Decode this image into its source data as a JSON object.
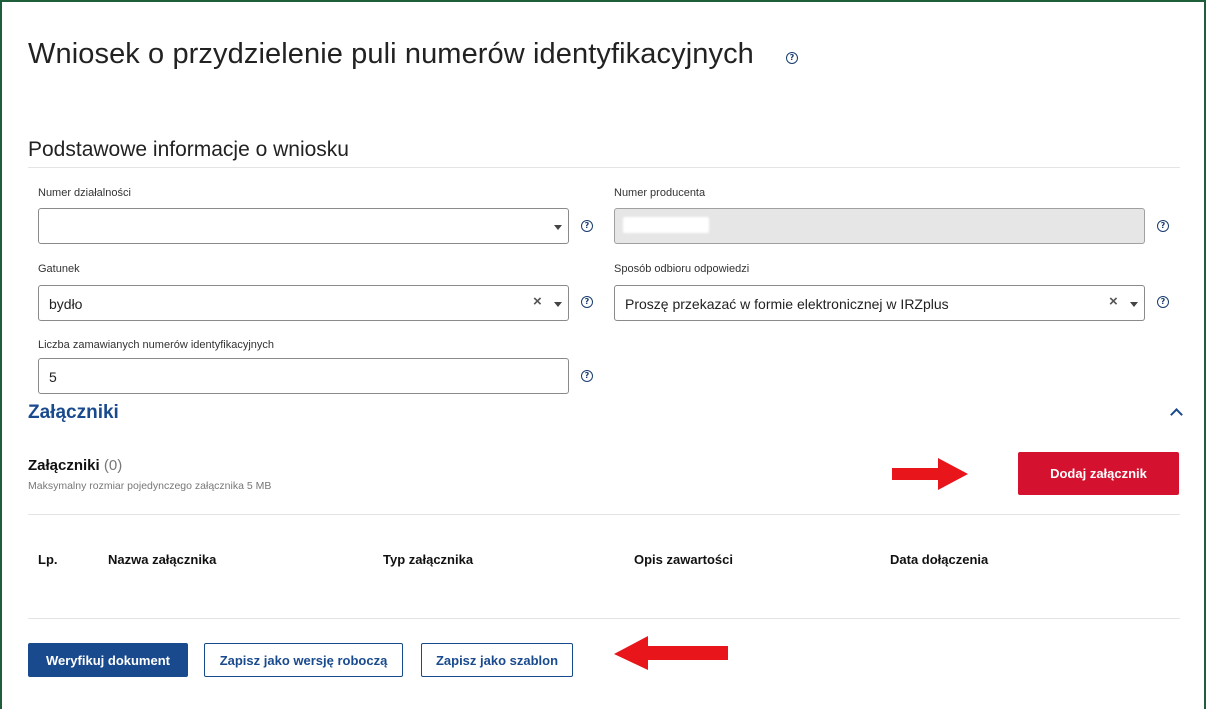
{
  "page": {
    "title": "Wniosek o przydzielenie puli numerów identyfikacyjnych",
    "section_title": "Podstawowe informacje o wniosku"
  },
  "form": {
    "numer_dzialalnosci": {
      "label": "Numer działalności",
      "value": ""
    },
    "numer_producenta": {
      "label": "Numer producenta",
      "value": ""
    },
    "gatunek": {
      "label": "Gatunek",
      "value": "bydło"
    },
    "sposob_odbioru": {
      "label": "Sposób odbioru odpowiedzi",
      "value": "Proszę przekazać w formie elektronicznej w IRZplus"
    },
    "liczba_numerow": {
      "label": "Liczba zamawianych numerów identyfikacyjnych",
      "value": "5"
    }
  },
  "attachments": {
    "heading": "Załączniki",
    "list_title": "Załączniki",
    "count": "(0)",
    "max_size_note": "Maksymalny rozmiar pojedynczego załącznika 5 MB",
    "add_button": "Dodaj załącznik",
    "columns": [
      "Lp.",
      "Nazwa załącznika",
      "Typ załącznika",
      "Opis zawartości",
      "Data dołączenia"
    ]
  },
  "actions": {
    "verify": "Weryfikuj dokument",
    "save_draft": "Zapisz jako wersję roboczą",
    "save_template": "Zapisz jako szablon"
  },
  "icons": {
    "help": "?",
    "clear": "×"
  },
  "colors": {
    "primary": "#1a4a8e",
    "danger": "#d4122f",
    "arrow": "#e8151b",
    "frame": "#1e5e3a"
  }
}
